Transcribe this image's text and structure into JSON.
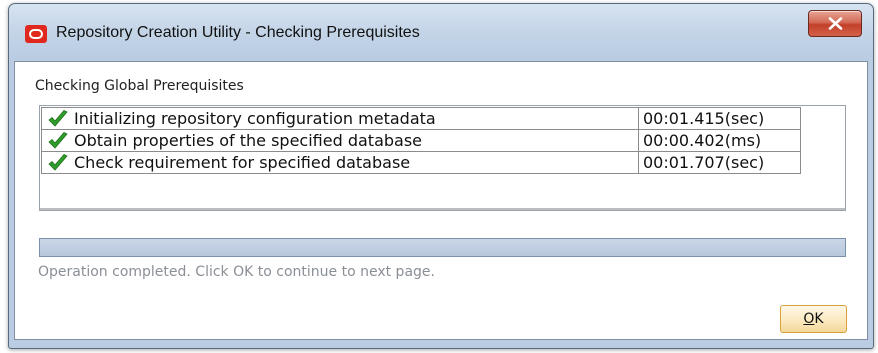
{
  "window": {
    "title": "Repository Creation Utility - Checking Prerequisites",
    "app_icon": "oracle-logo-icon",
    "close_icon": "close-icon"
  },
  "section": {
    "title": "Checking Global Prerequisites"
  },
  "tasks": [
    {
      "name": "Initializing repository configuration metadata",
      "time": "00:01.415(sec)",
      "status_icon": "checkmark-icon"
    },
    {
      "name": "Obtain properties of the specified database",
      "time": "00:00.402(ms)",
      "status_icon": "checkmark-icon"
    },
    {
      "name": "Check requirement for specified database",
      "time": "00:01.707(sec)",
      "status_icon": "checkmark-icon"
    }
  ],
  "progress": {
    "value": 1.0
  },
  "status": {
    "message": "Operation completed. Click OK to continue to next page."
  },
  "buttons": {
    "ok_mnemonic": "O",
    "ok_rest": "K"
  },
  "colors": {
    "check_green": "#2e9e2a",
    "close_red": "#c2402a",
    "brand_red": "#e0291c"
  }
}
